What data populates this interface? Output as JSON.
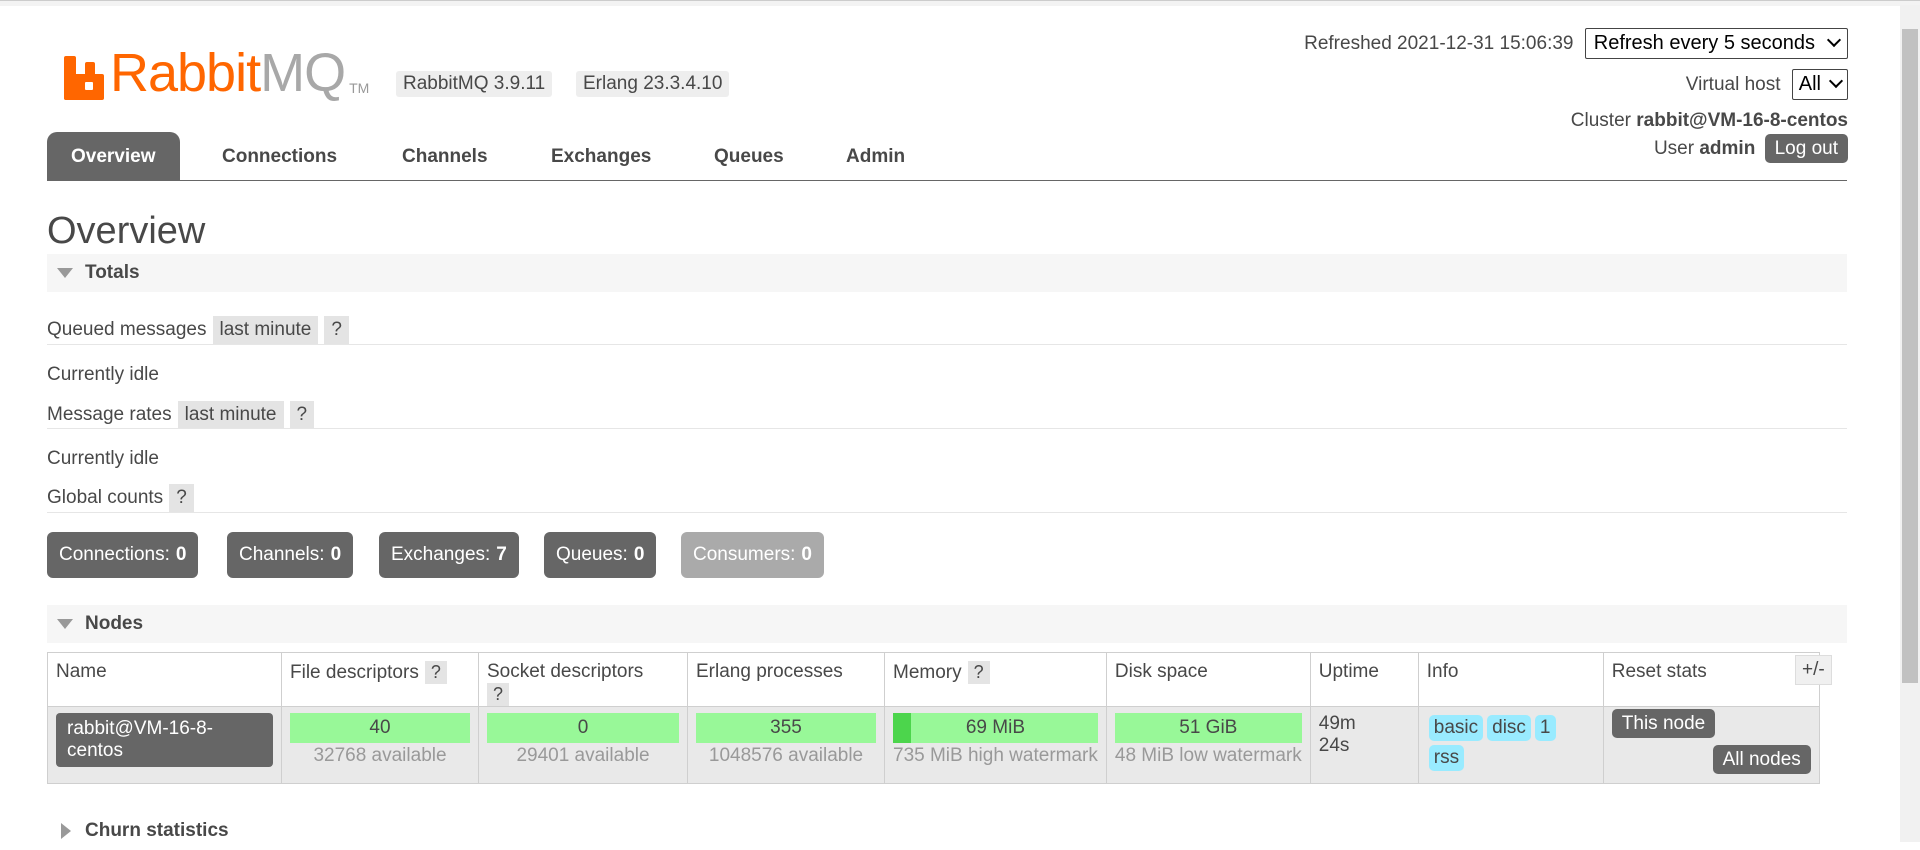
{
  "brand": {
    "name_orange": "Rabbit",
    "name_gray": "MQ",
    "tm": "TM"
  },
  "versions": {
    "rabbitmq": "RabbitMQ 3.9.11",
    "erlang": "Erlang 23.3.4.10"
  },
  "header": {
    "refreshed": "Refreshed 2021-12-31 15:06:39",
    "refresh_select": "Refresh every 5 seconds",
    "vhost_label": "Virtual host",
    "vhost_select": "All",
    "cluster_label": "Cluster",
    "cluster_name": "rabbit@VM-16-8-centos",
    "user_label": "User",
    "user_name": "admin",
    "logout": "Log out"
  },
  "tabs": [
    "Overview",
    "Connections",
    "Channels",
    "Exchanges",
    "Queues",
    "Admin"
  ],
  "page_title": "Overview",
  "totals": {
    "section_label": "Totals",
    "queued_label": "Queued messages",
    "queued_chip": "last minute",
    "help": "?",
    "queued_status": "Currently idle",
    "rates_label": "Message rates",
    "rates_chip": "last minute",
    "rates_status": "Currently idle",
    "global_label": "Global counts",
    "counters": [
      {
        "label": "Connections:",
        "value": "0"
      },
      {
        "label": "Channels:",
        "value": "0"
      },
      {
        "label": "Exchanges:",
        "value": "7"
      },
      {
        "label": "Queues:",
        "value": "0"
      },
      {
        "label": "Consumers:",
        "value": "0"
      }
    ]
  },
  "nodes": {
    "section_label": "Nodes",
    "columns": [
      "Name",
      "File descriptors",
      "Socket descriptors",
      "Erlang processes",
      "Memory",
      "Disk space",
      "Uptime",
      "Info",
      "Reset stats"
    ],
    "plus_minus": "+/-",
    "row": {
      "name": "rabbit@VM-16-8-centos",
      "fd": "40",
      "fd_sub": "32768 available",
      "sd": "0",
      "sd_sub": "29401 available",
      "ep": "355",
      "ep_sub": "1048576 available",
      "mem": "69 MiB",
      "mem_sub": "735 MiB high watermark",
      "mem_fraction": 0.09,
      "disk": "51 GiB",
      "disk_sub": "48 MiB low watermark",
      "uptime_1": "49m",
      "uptime_2": "24s",
      "info": [
        "basic",
        "disc",
        "1",
        "rss"
      ],
      "reset_this": "This node",
      "reset_all": "All nodes"
    }
  },
  "churn": {
    "section_label": "Churn statistics"
  }
}
